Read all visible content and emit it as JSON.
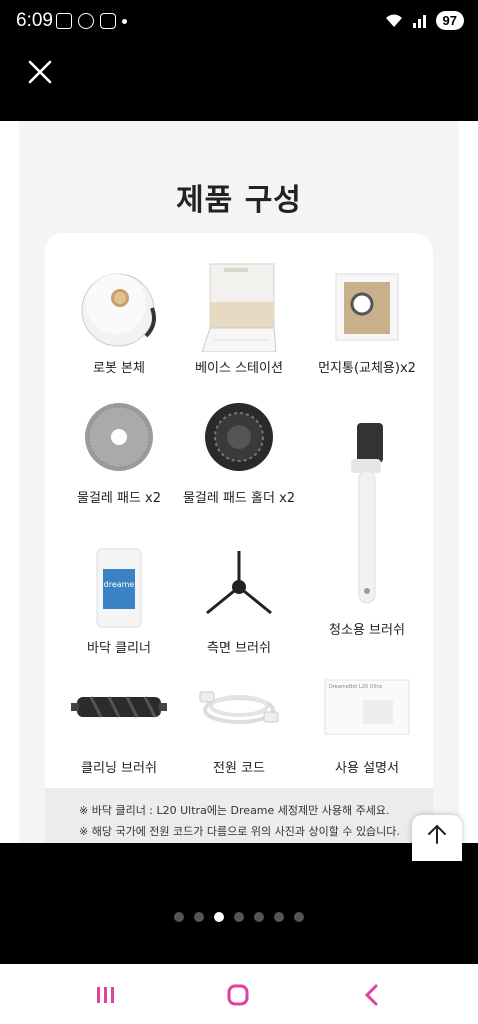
{
  "status_bar": {
    "time": "6:09",
    "battery": "97"
  },
  "page": {
    "title": "제품 구성"
  },
  "items": [
    {
      "label": "로봇 본체",
      "icon": "robot-body-image"
    },
    {
      "label": "베이스 스테이션",
      "icon": "base-station-image"
    },
    {
      "label": "먼지통(교체용)x2",
      "icon": "dust-bag-image"
    },
    {
      "label": "물걸레 패드 x2",
      "icon": "mop-pad-image"
    },
    {
      "label": "물걸레 패드 홀더 x2",
      "icon": "mop-holder-image"
    },
    {
      "label": "바닥 클리너",
      "icon": "floor-cleaner-image"
    },
    {
      "label": "측면 브러쉬",
      "icon": "side-brush-image"
    },
    {
      "label": "청소용 브러쉬",
      "icon": "cleaning-brush-image"
    },
    {
      "label": "클리닝 브러쉬",
      "icon": "roller-brush-image"
    },
    {
      "label": "전원 코드",
      "icon": "power-cord-image"
    },
    {
      "label": "사용 설명서",
      "icon": "manual-image"
    }
  ],
  "manual_cover_text": "DreameBot L20 Ultra",
  "cleaner_bottle_text": "dreame",
  "notes": [
    "※ 바닥 클리너 : L20 Ultra에는 Dreame 세정제만 사용해 주세요.",
    "※ 해당 국가에 전원 코드가 다름으로 위의 사진과 상이할 수 있습니다."
  ],
  "carousel": {
    "count": 7,
    "active_index": 2
  },
  "colors": {
    "accent": "#e040a0",
    "panel_bg": "#f4f4f4"
  }
}
